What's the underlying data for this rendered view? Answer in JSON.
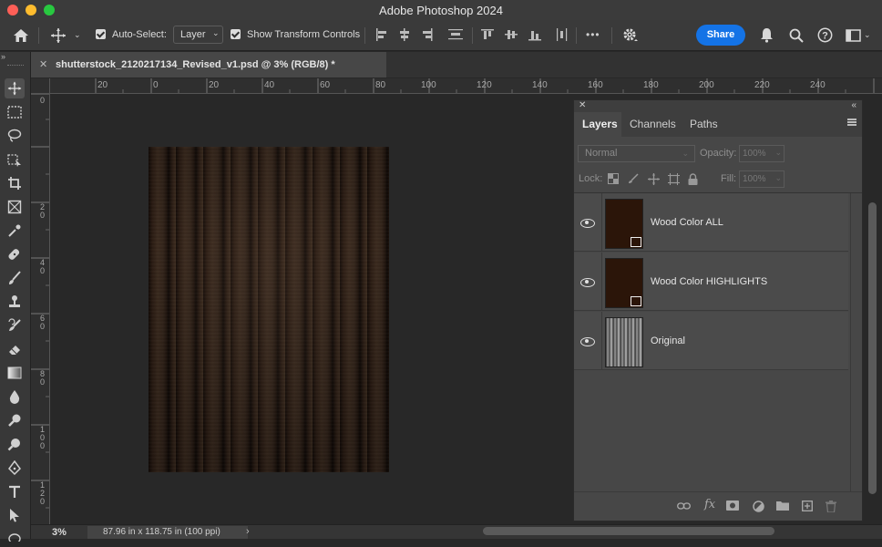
{
  "window": {
    "title": "Adobe Photoshop 2024"
  },
  "options_bar": {
    "auto_select_label": "Auto-Select:",
    "auto_select_target": "Layer",
    "show_transform_label": "Show Transform Controls",
    "more_label": "•••",
    "share_label": "Share"
  },
  "document": {
    "tab_title": "shutterstock_2120217134_Revised_v1.psd @ 3% (RGB/8) *",
    "close_label": "✕"
  },
  "rulers": {
    "horizontal": [
      "20",
      "0",
      "20",
      "40",
      "60",
      "80",
      "100",
      "120",
      "140",
      "160",
      "180",
      "200",
      "220",
      "240"
    ],
    "vertical": [
      "0",
      "20",
      "40",
      "60",
      "80",
      "100",
      "120"
    ]
  },
  "status": {
    "zoom": "3%",
    "doc_info": "87.96 in x 118.75 in (100 ppi)",
    "chevron": "›"
  },
  "layers_panel": {
    "tabs": [
      "Layers",
      "Channels",
      "Paths"
    ],
    "active_tab": "Layers",
    "blend_mode": "Normal",
    "opacity_label": "Opacity:",
    "opacity_value": "100%",
    "lock_label": "Lock:",
    "fill_label": "Fill:",
    "fill_value": "100%",
    "layers": [
      {
        "name": "Wood Color ALL",
        "visible": true,
        "has_mask": true
      },
      {
        "name": "Wood Color HIGHLIGHTS",
        "visible": true,
        "has_mask": true
      },
      {
        "name": "Original",
        "visible": true,
        "has_mask": false
      }
    ]
  },
  "colors": {
    "accent": "#1473e6",
    "traffic_red": "#fe5f57",
    "traffic_yellow": "#febc2e",
    "traffic_green": "#28c840",
    "layer_fill": "#2b1509"
  }
}
